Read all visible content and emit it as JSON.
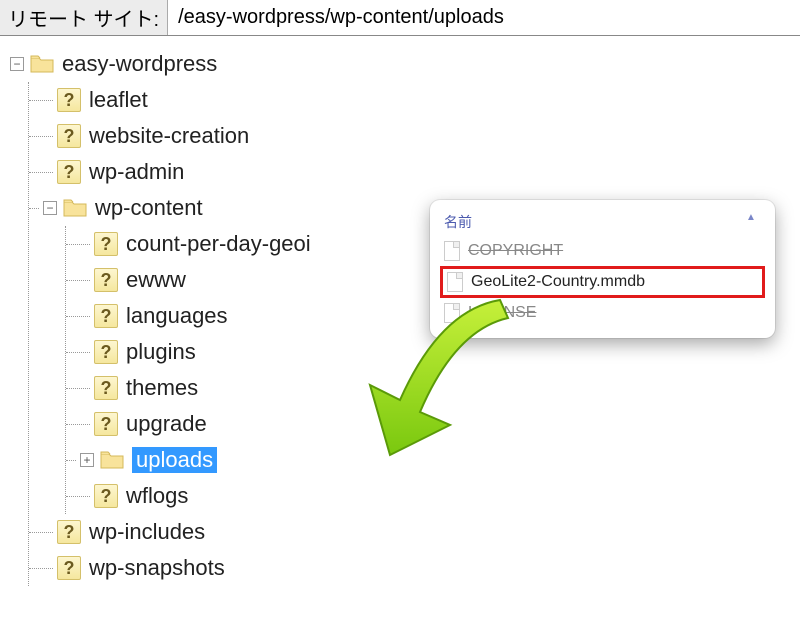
{
  "address": {
    "label": "リモート サイト:",
    "path": "/easy-wordpress/wp-content/uploads"
  },
  "tree": {
    "root": {
      "name": "easy-wordpress",
      "expanded": true,
      "children": [
        {
          "name": "leaflet",
          "type": "unknown"
        },
        {
          "name": "website-creation",
          "type": "unknown"
        },
        {
          "name": "wp-admin",
          "type": "unknown"
        },
        {
          "name": "wp-content",
          "type": "folder",
          "expanded": true,
          "children": [
            {
              "name": "count-per-day-geoi",
              "type": "unknown"
            },
            {
              "name": "ewww",
              "type": "unknown"
            },
            {
              "name": "languages",
              "type": "unknown"
            },
            {
              "name": "plugins",
              "type": "unknown"
            },
            {
              "name": "themes",
              "type": "unknown"
            },
            {
              "name": "upgrade",
              "type": "unknown"
            },
            {
              "name": "uploads",
              "type": "folder",
              "collapsed": true,
              "selected": true
            },
            {
              "name": "wflogs",
              "type": "unknown"
            }
          ]
        },
        {
          "name": "wp-includes",
          "type": "unknown"
        },
        {
          "name": "wp-snapshots",
          "type": "unknown"
        }
      ]
    }
  },
  "popup": {
    "header": "名前",
    "files": [
      {
        "name": "COPYRIGHT",
        "dim": true
      },
      {
        "name": "GeoLite2-Country.mmdb",
        "highlight": true
      },
      {
        "name": "LICENSE",
        "dim": true
      }
    ]
  },
  "symbols": {
    "minus": "−",
    "plus": "+",
    "sort": "▲"
  }
}
